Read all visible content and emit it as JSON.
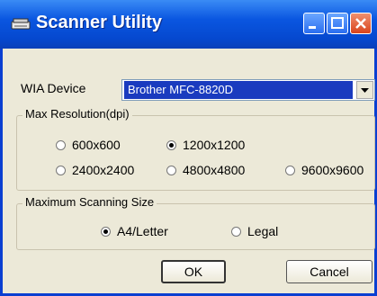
{
  "window": {
    "title": "Scanner Utility"
  },
  "wia": {
    "label": "WIA Device",
    "selected": "Brother MFC-8820D"
  },
  "resolution": {
    "group_label": "Max Resolution(dpi)",
    "options": [
      "600x600",
      "1200x1200",
      "2400x2400",
      "4800x4800",
      "9600x9600"
    ],
    "selected": "1200x1200"
  },
  "size": {
    "group_label": "Maximum Scanning Size",
    "options": [
      "A4/Letter",
      "Legal"
    ],
    "selected": "A4/Letter"
  },
  "buttons": {
    "ok": "OK",
    "cancel": "Cancel"
  }
}
